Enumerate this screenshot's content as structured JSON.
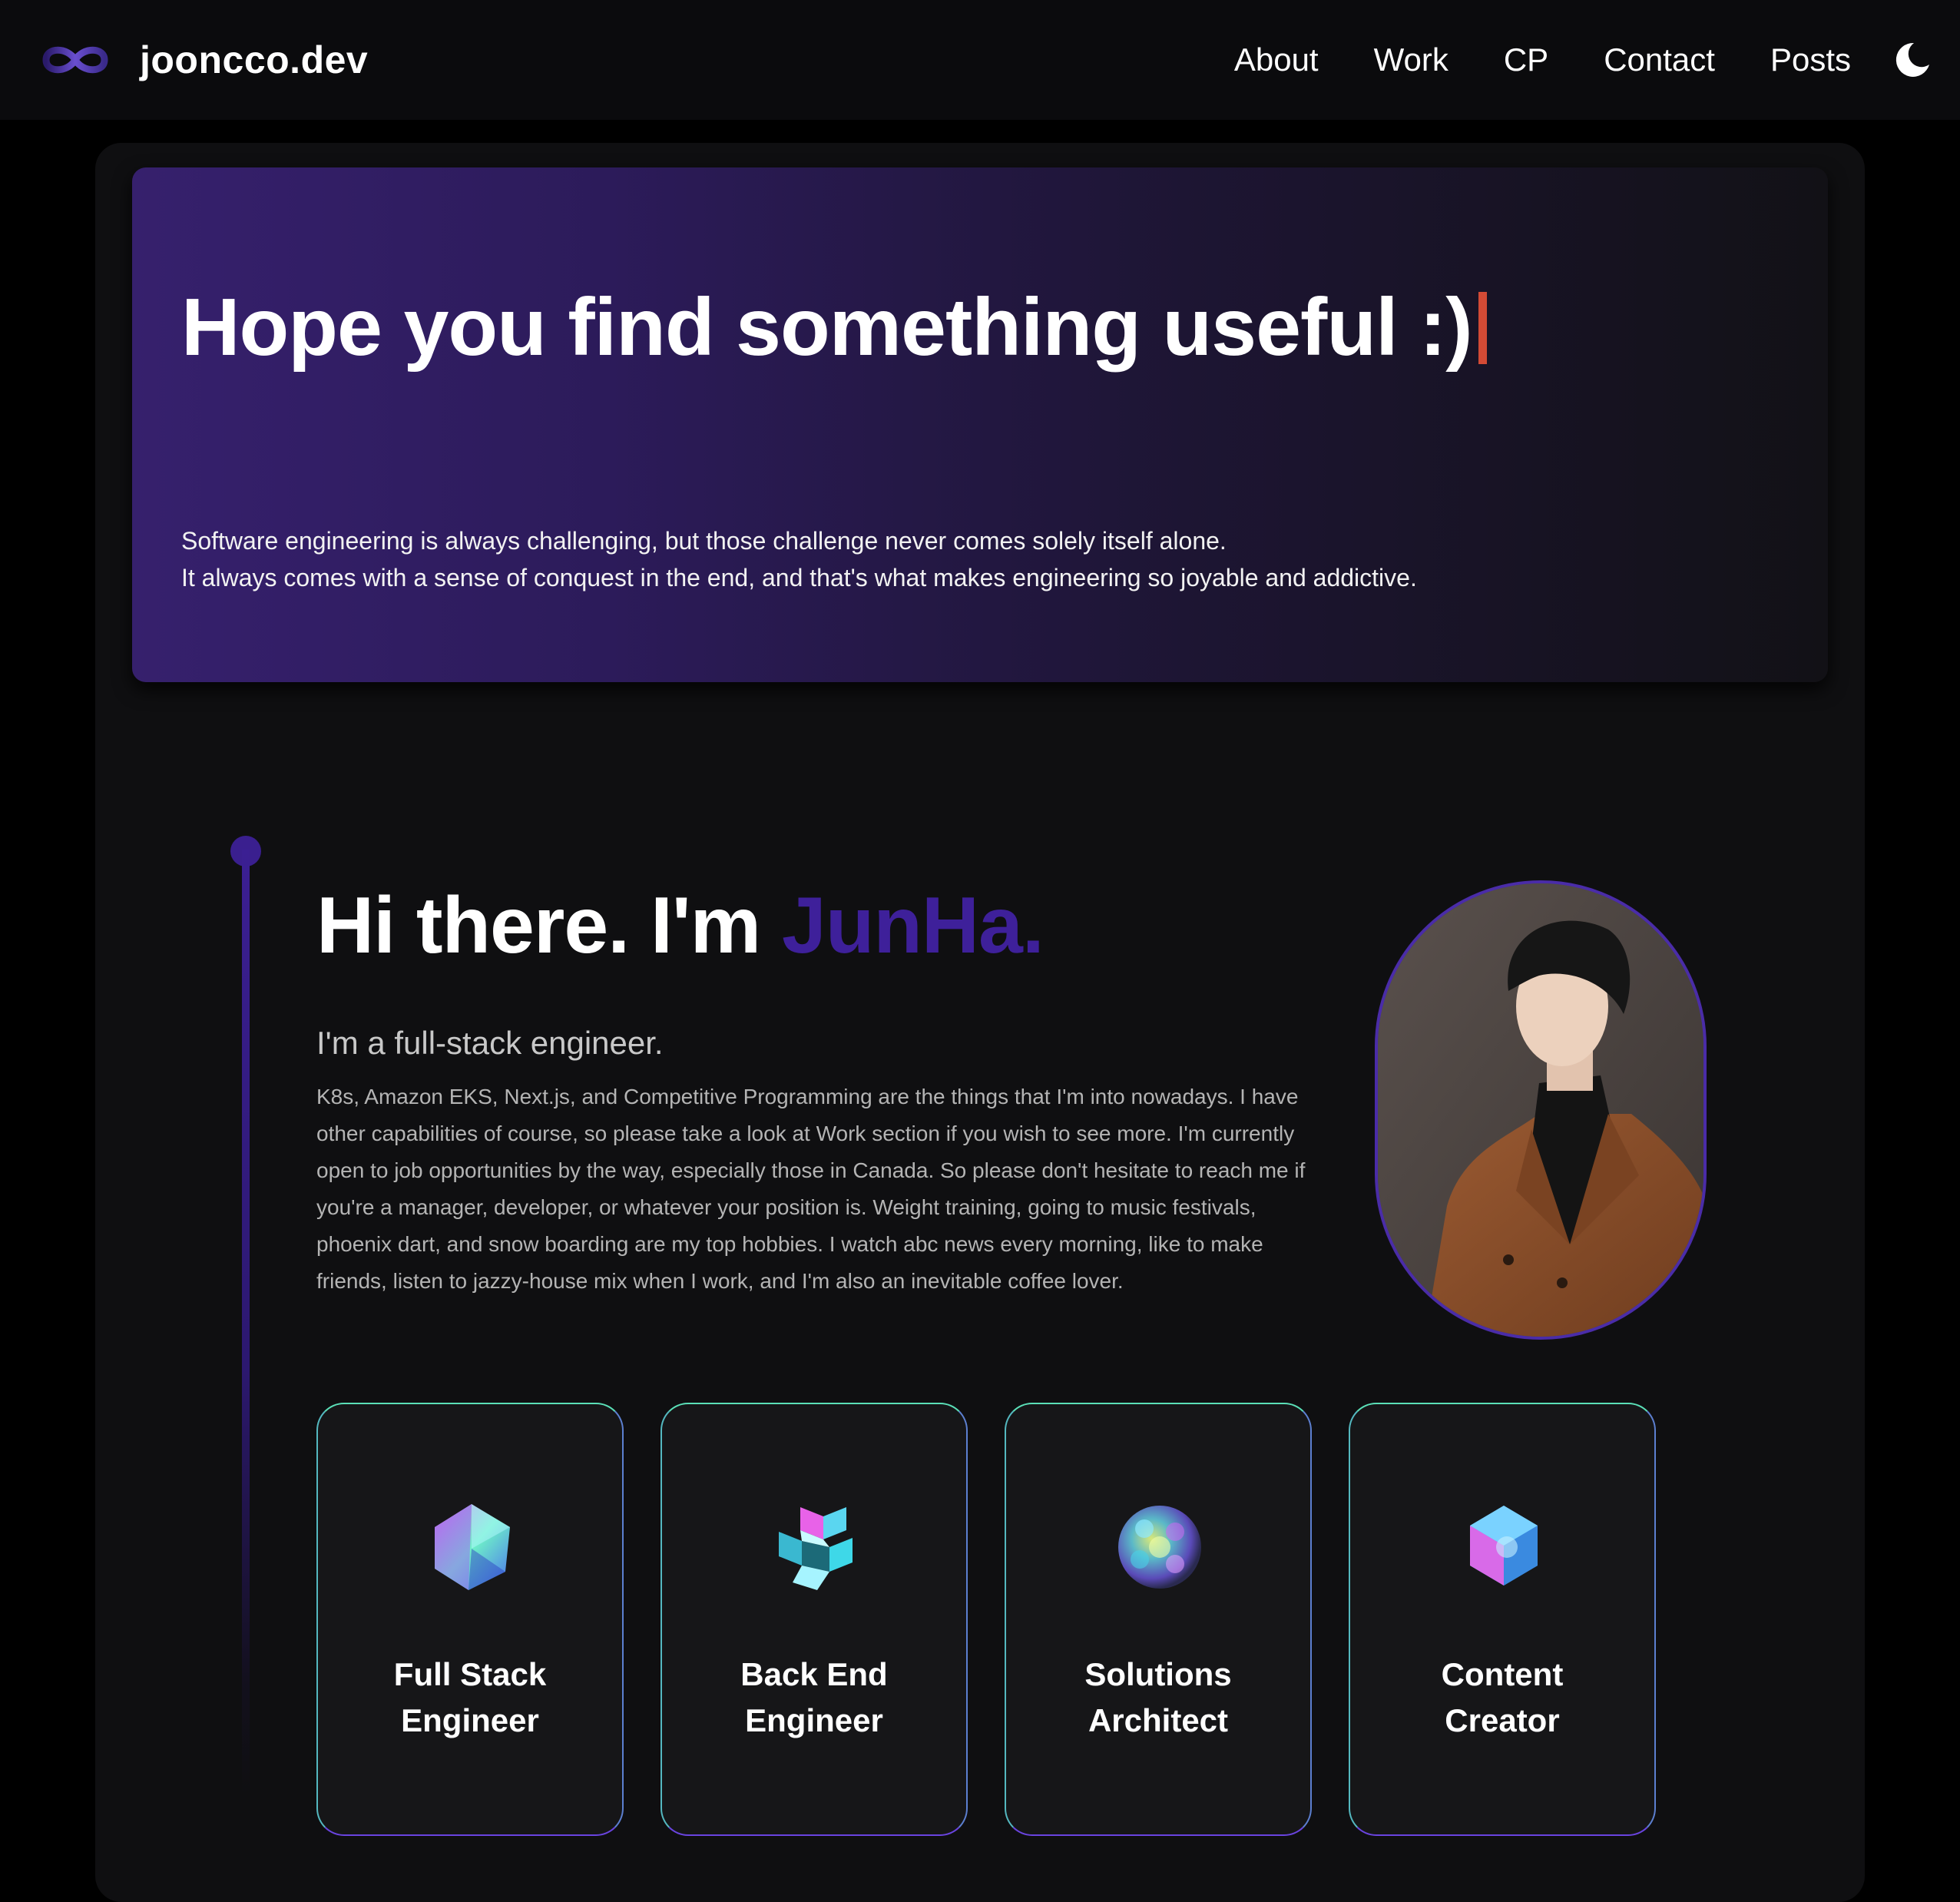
{
  "nav": {
    "brand": "jooncco.dev",
    "items": [
      "About",
      "Work",
      "CP",
      "Contact",
      "Posts"
    ],
    "theme_icon": "moon-icon"
  },
  "hero": {
    "title": "Hope you find something useful :)",
    "lines": [
      "Software engineering is always challenging, but those challenge never comes solely itself alone.",
      "It always comes with a sense of conquest in the end, and that's what makes engineering so joyable and addictive."
    ]
  },
  "intro": {
    "greeting": "Hi there. I'm ",
    "name": "JunHa.",
    "subtitle": "I'm a full-stack engineer.",
    "bio": "K8s, Amazon EKS, Next.js, and Competitive Programming are the things that I'm into nowadays. I have other capabilities of course, so please take a look at Work section if you wish to see more. I'm currently open to job opportunities by the way, especially those in Canada. So please don't hesitate to reach me if you're a manager, developer, or whatever your position is. Weight training, going to music festivals, phoenix dart, and snow boarding are my top hobbies. I watch abc news every morning, like to make friends, listen to jazzy-house mix when I work, and I'm also an inevitable coffee lover.",
    "avatar_icon": "profile-photo"
  },
  "roles": [
    {
      "line1": "Full Stack",
      "line2": "Engineer",
      "icon": "crystal-icon"
    },
    {
      "line1": "Back End",
      "line2": "Engineer",
      "icon": "cube-cluster-icon"
    },
    {
      "line1": "Solutions",
      "line2": "Architect",
      "icon": "sphere-icon"
    },
    {
      "line1": "Content",
      "line2": "Creator",
      "icon": "hexagon-icon"
    }
  ],
  "colors": {
    "accent": "#3e209a",
    "caret": "#d34a35",
    "card_border_top": "#5be0b8",
    "card_border_bottom": "#6a44e0"
  }
}
